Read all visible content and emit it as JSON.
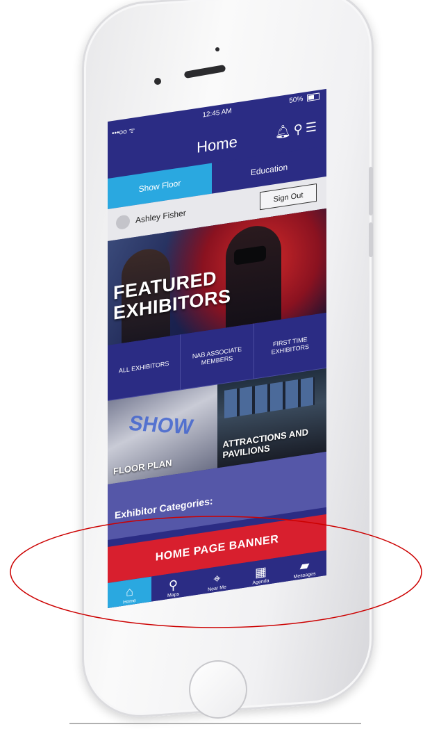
{
  "status_bar": {
    "carrier": "•••oo ᯤ",
    "time": "12:45 AM",
    "battery": "50%"
  },
  "header": {
    "title": "Home",
    "bell_icon": "bell-icon",
    "search_icon": "search-icon",
    "menu_icon": "list-icon"
  },
  "tabs": [
    {
      "label": "Show Floor",
      "active": true
    },
    {
      "label": "Education",
      "active": false
    }
  ],
  "user": {
    "name": "Ashley Fisher",
    "signout_label": "Sign Out"
  },
  "featured": {
    "headline_line1": "FEATURED",
    "headline_line2": "EXHIBITORS"
  },
  "categories": [
    {
      "label": "ALL EXHIBITORS"
    },
    {
      "label": "NAB ASSOCIATE MEMBERS"
    },
    {
      "label": "FIRST TIME EXHIBITORS"
    }
  ],
  "tiles": {
    "floor_plan": "FLOOR PLAN",
    "floor_plan_art": "SHOW",
    "attractions_line1": "ATTRACTIONS AND",
    "attractions_line2": "PAVILIONS"
  },
  "exhibitor_categories": "Exhibitor Categories:",
  "banner": "HOME PAGE BANNER",
  "bottom_nav": [
    {
      "label": "Home",
      "icon": "home-icon",
      "active": true
    },
    {
      "label": "Maps",
      "icon": "map-icon",
      "active": false
    },
    {
      "label": "Near Me",
      "icon": "location-icon",
      "active": false
    },
    {
      "label": "Agenda",
      "icon": "calendar-icon",
      "active": false
    },
    {
      "label": "Messages",
      "icon": "folder-icon",
      "active": false
    }
  ],
  "colors": {
    "screen_bg": "#2b2c84",
    "active_tab": "#2aa8e0",
    "banner": "#d81f2e",
    "annotation": "#cc0000"
  }
}
